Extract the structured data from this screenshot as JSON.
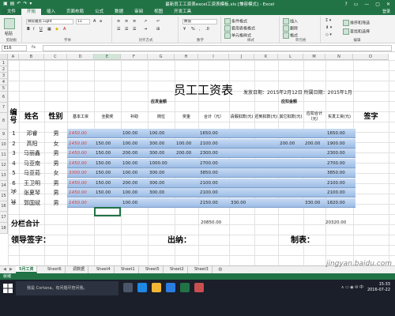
{
  "window": {
    "title": "最新员工工资表excel工资表模板.xls [兼容模式] - Excel",
    "controls": [
      "?",
      "▭",
      "—",
      "▢",
      "✕"
    ]
  },
  "menu": {
    "tabs": [
      "文件",
      "开始",
      "插入",
      "页面布局",
      "公式",
      "数据",
      "审阅",
      "视图",
      "开发工具"
    ],
    "active": 1,
    "user": "登录"
  },
  "ribbon": {
    "clipboard_label": "剪贴板",
    "paste": "粘贴",
    "font_name": "微软雅黑 Light",
    "font_size": "11",
    "font_label": "字体",
    "align_label": "对齐方式",
    "number_format": "数值",
    "number_label": "数字",
    "cond_format": "条件格式",
    "table_format": "套用表格格式",
    "cell_styles": "单元格样式",
    "styles_label": "样式",
    "insert": "插入",
    "delete": "删除",
    "format": "格式",
    "cells_label": "单元格",
    "sort": "排序和筛选",
    "find": "查找和选择",
    "edit_label": "编辑"
  },
  "formula_bar": {
    "name_box": "E16",
    "fx": "fx",
    "value": ""
  },
  "columns": [
    "A",
    "B",
    "C",
    "D",
    "E",
    "F",
    "G",
    "H",
    "I",
    "J",
    "K",
    "L",
    "M",
    "N",
    "O"
  ],
  "rows": [
    "1",
    "2",
    "3",
    "4",
    "5",
    "6",
    "7",
    "8",
    "9",
    "10",
    "11",
    "12",
    "13",
    "14",
    "15",
    "16",
    "17",
    "18"
  ],
  "sheet": {
    "title": "员工工资表",
    "issue_date": "发放日期：2015年2月12日 所属日期：2015年1月",
    "group_income": "应发金额",
    "group_deduct": "应扣金额",
    "headers": {
      "no": "编号",
      "name": "姓名",
      "gender": "性别",
      "base": "基本工资",
      "attendance": "全勤奖",
      "subsidy": "补助",
      "position": "岗位",
      "bonus": "奖金",
      "total": "合计（元）",
      "leave": "请假扣款(元)",
      "late": "迟到扣款(元)",
      "other": "其它扣款(元)",
      "deduct_total": "应扣合计（元）",
      "net": "实发工资(元)",
      "sign": "签字"
    },
    "employees": [
      {
        "no": "1",
        "name": "邓睿",
        "gender": "男",
        "base": "1450.00",
        "attendance": "",
        "subsidy": "100.00",
        "position": "100.00",
        "bonus": "",
        "total": "1650.00",
        "leave": "",
        "late": "",
        "other": "",
        "deduct_total": "",
        "net": "1650.00"
      },
      {
        "no": "2",
        "name": "高阳",
        "gender": "女",
        "base": "1450.00",
        "attendance": "150.00",
        "subsidy": "100.00",
        "position": "300.00",
        "bonus": "100.00",
        "total": "2100.00",
        "leave": "",
        "late": "",
        "other": "200.00",
        "deduct_total": "200.00",
        "net": "1900.00"
      },
      {
        "no": "3",
        "name": "马丽鑫",
        "gender": "男",
        "base": "1450.00",
        "attendance": "150.00",
        "subsidy": "200.00",
        "position": "300.00",
        "bonus": "200.00",
        "total": "2300.00",
        "leave": "",
        "late": "",
        "other": "",
        "deduct_total": "",
        "net": "2300.00"
      },
      {
        "no": "4",
        "name": "马亚南",
        "gender": "男",
        "base": "1450.00",
        "attendance": "150.00",
        "subsidy": "100.00",
        "position": "1000.00",
        "bonus": "",
        "total": "2700.00",
        "leave": "",
        "late": "",
        "other": "",
        "deduct_total": "",
        "net": "2700.00"
      },
      {
        "no": "5",
        "name": "马亚茹",
        "gender": "女",
        "base": "3300.00",
        "attendance": "150.00",
        "subsidy": "100.00",
        "position": "300.00",
        "bonus": "",
        "total": "3850.00",
        "leave": "",
        "late": "",
        "other": "",
        "deduct_total": "",
        "net": "3850.00"
      },
      {
        "no": "6",
        "name": "王卫明",
        "gender": "男",
        "base": "1450.00",
        "attendance": "150.00",
        "subsidy": "200.00",
        "position": "300.00",
        "bonus": "",
        "total": "2100.00",
        "leave": "",
        "late": "",
        "other": "",
        "deduct_total": "",
        "net": "2100.00"
      },
      {
        "no": "7",
        "name": "张夏琴",
        "gender": "男",
        "base": "1450.00",
        "attendance": "150.00",
        "subsidy": "100.00",
        "position": "300.00",
        "bonus": "",
        "total": "2100.00",
        "leave": "",
        "late": "",
        "other": "",
        "deduct_total": "",
        "net": "2100.00"
      },
      {
        "no": "8",
        "name": "郭国斌",
        "gender": "男",
        "base": "1450.00",
        "attendance": "",
        "subsidy": "100.00",
        "position": "",
        "bonus": "",
        "total": "2150.00",
        "leave": "330.00",
        "late": "",
        "other": "",
        "deduct_total": "330.00",
        "net": "1820.00"
      }
    ],
    "extra_rows": [
      "10",
      "11"
    ],
    "subtotal_label": "分栏合计",
    "subtotal_total": "20850.00",
    "subtotal_net": "20320.00",
    "footer": {
      "leader": "领导签字：",
      "cashier": "出纳：",
      "maker": "制表："
    }
  },
  "sheet_tabs": [
    "5月工资",
    "Sheet6",
    "调数据",
    "Sheet4",
    "Sheet1",
    "Sheet5",
    "Sheet2",
    "Sheet3"
  ],
  "active_sheet": 0,
  "status": "就绪",
  "taskbar": {
    "search_placeholder": "我是 Cortana。有问题尽管问我。",
    "time": "15:33",
    "date": "2016-07-22"
  },
  "watermark": "jingyan.baidu.com",
  "colors": {
    "excel_green": "#217346",
    "band_blue": "#9dbde6",
    "red_text": "#d23c3c"
  }
}
